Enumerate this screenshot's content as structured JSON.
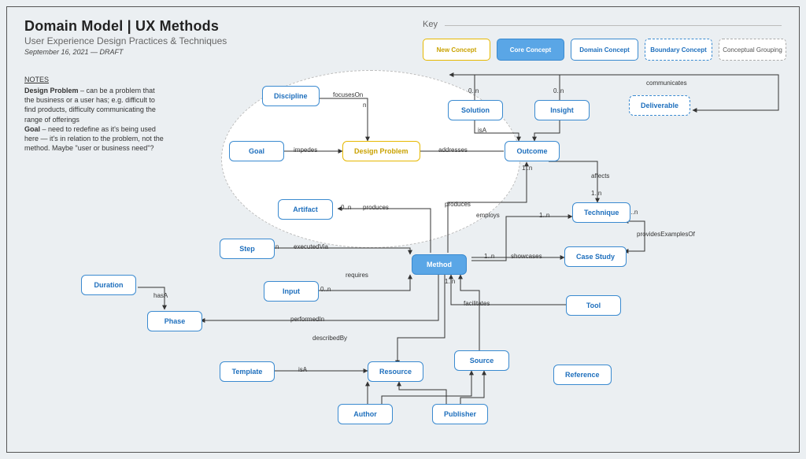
{
  "header": {
    "title": "Domain Model | UX Methods",
    "subtitle": "User Experience Design Practices & Techniques",
    "dateline": "September 16, 2021 — DRAFT"
  },
  "notes": {
    "heading": "NOTES",
    "body_html": "<b>Design Problem</b> – can be a problem that the business or a user has; e.g. difficult to find products, difficulty communicating the range of offerings<br><b>Goal</b> – need to redefine as it's being used here — it's in relation to the problem, not the method. Maybe \"user or business need\"?"
  },
  "key": {
    "label": "Key",
    "items": [
      {
        "id": "new",
        "label": "New Concept"
      },
      {
        "id": "core",
        "label": "Core Concept"
      },
      {
        "id": "domain",
        "label": "Domain Concept"
      },
      {
        "id": "boundary",
        "label": "Boundary Concept"
      },
      {
        "id": "group",
        "label": "Conceptual Grouping"
      }
    ]
  },
  "nodes": {
    "discipline": "Discipline",
    "goal": "Goal",
    "designProblem": "Design Problem",
    "artifact": "Artifact",
    "solution": "Solution",
    "insight": "Insight",
    "outcome": "Outcome",
    "deliverable": "Deliverable",
    "technique": "Technique",
    "caseStudy": "Case Study",
    "step": "Step",
    "method": "Method",
    "duration": "Duration",
    "input": "Input",
    "tool": "Tool",
    "phase": "Phase",
    "template": "Template",
    "resource": "Resource",
    "source": "Source",
    "reference": "Reference",
    "author": "Author",
    "publisher": "Publisher"
  },
  "edgeLabels": {
    "focusesOn": "focusesOn",
    "impedes": "impedes",
    "addresses": "addresses",
    "isA": "isA",
    "communicates": "communicates",
    "affects": "affects",
    "produces": "produces",
    "employs": "employs",
    "providesExamplesOf": "providesExamplesOf",
    "showcases": "showcases",
    "executedVia": "executedVia",
    "requires": "requires",
    "facilitates": "facilitates",
    "performedIn": "performedIn",
    "describedBy": "describedBy",
    "hasA": "hasA",
    "n": "n",
    "c0n": "0..n",
    "c1n": "1..n"
  }
}
